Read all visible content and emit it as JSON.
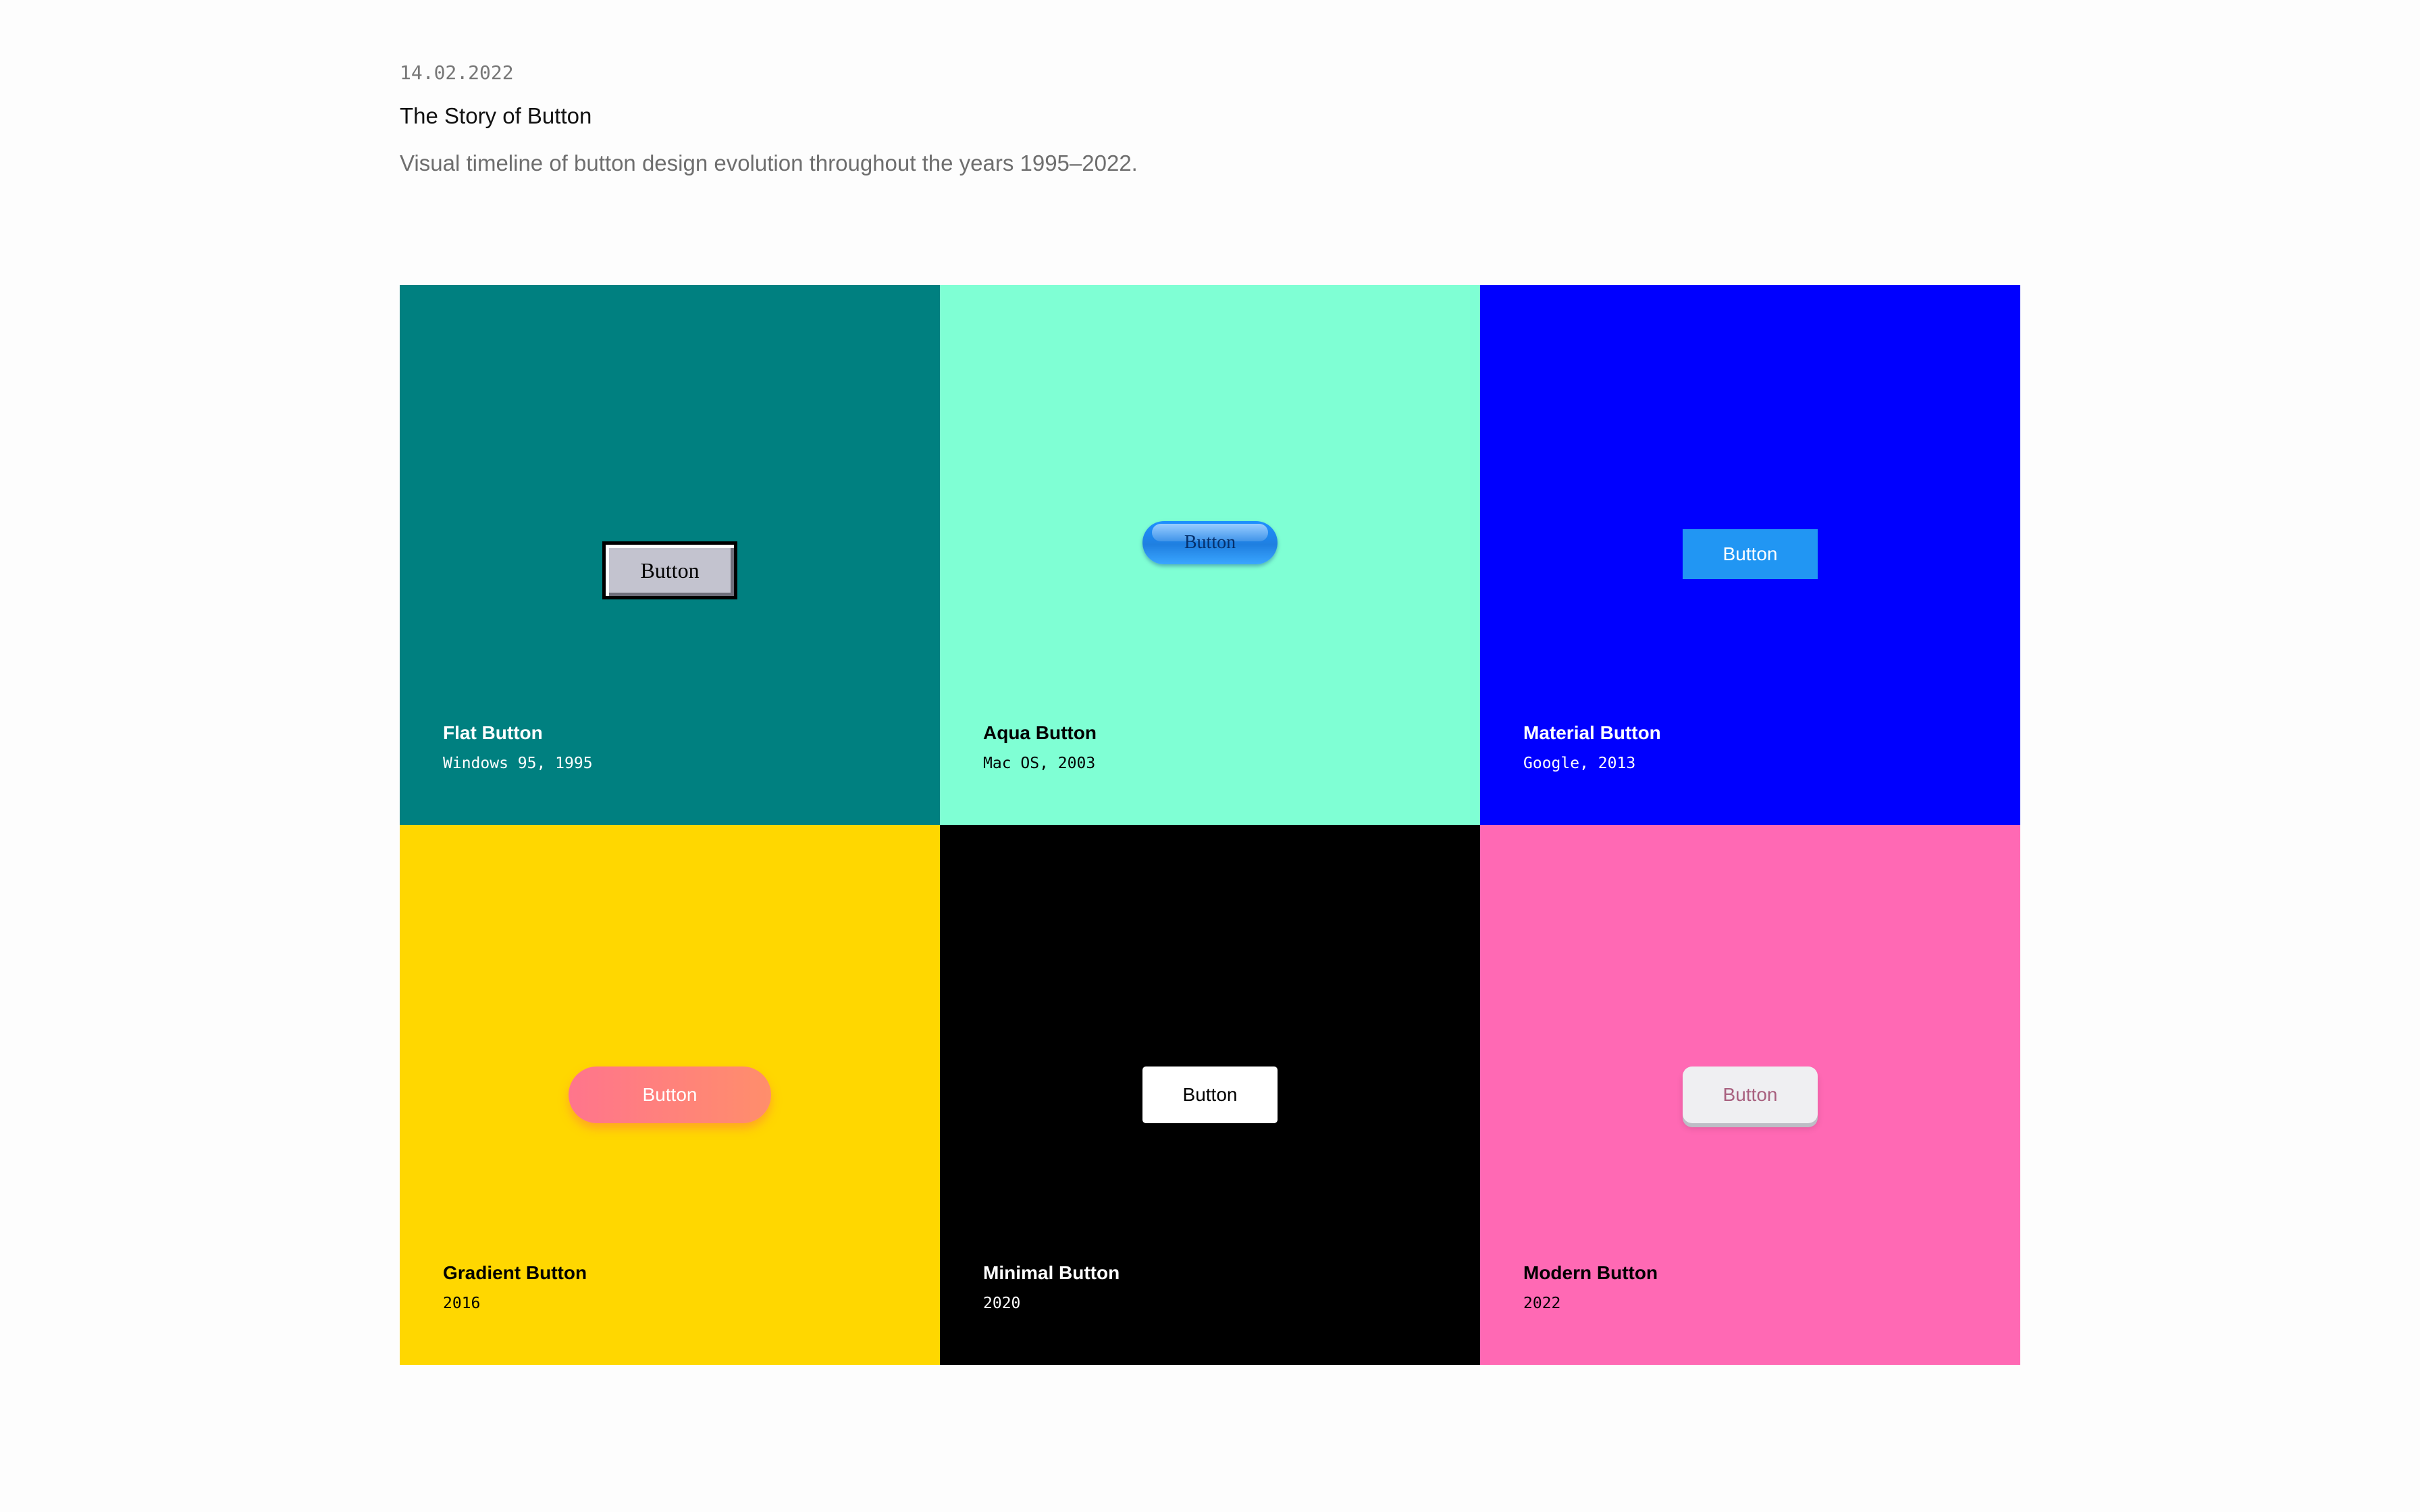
{
  "header": {
    "date": "14.02.2022",
    "title": "The Story of Button",
    "subtitle": "Visual timeline of button design evolution throughout the years 1995–2022."
  },
  "cards": [
    {
      "name": "Flat Button",
      "meta": "Windows 95, 1995",
      "button_label": "Button",
      "background": "#008080",
      "text_color": "#ffffff"
    },
    {
      "name": "Aqua Button",
      "meta": "Mac OS, 2003",
      "button_label": "Button",
      "background": "#7fffd4",
      "text_color": "#000000"
    },
    {
      "name": "Material Button",
      "meta": "Google, 2013",
      "button_label": "Button",
      "background": "#0000ff",
      "text_color": "#ffffff"
    },
    {
      "name": "Gradient Button",
      "meta": "2016",
      "button_label": "Button",
      "background": "#ffd700",
      "text_color": "#000000"
    },
    {
      "name": "Minimal Button",
      "meta": "2020",
      "button_label": "Button",
      "background": "#000000",
      "text_color": "#ffffff"
    },
    {
      "name": "Modern Button",
      "meta": "2022",
      "button_label": "Button",
      "background": "#ff69b4",
      "text_color": "#000000"
    }
  ]
}
